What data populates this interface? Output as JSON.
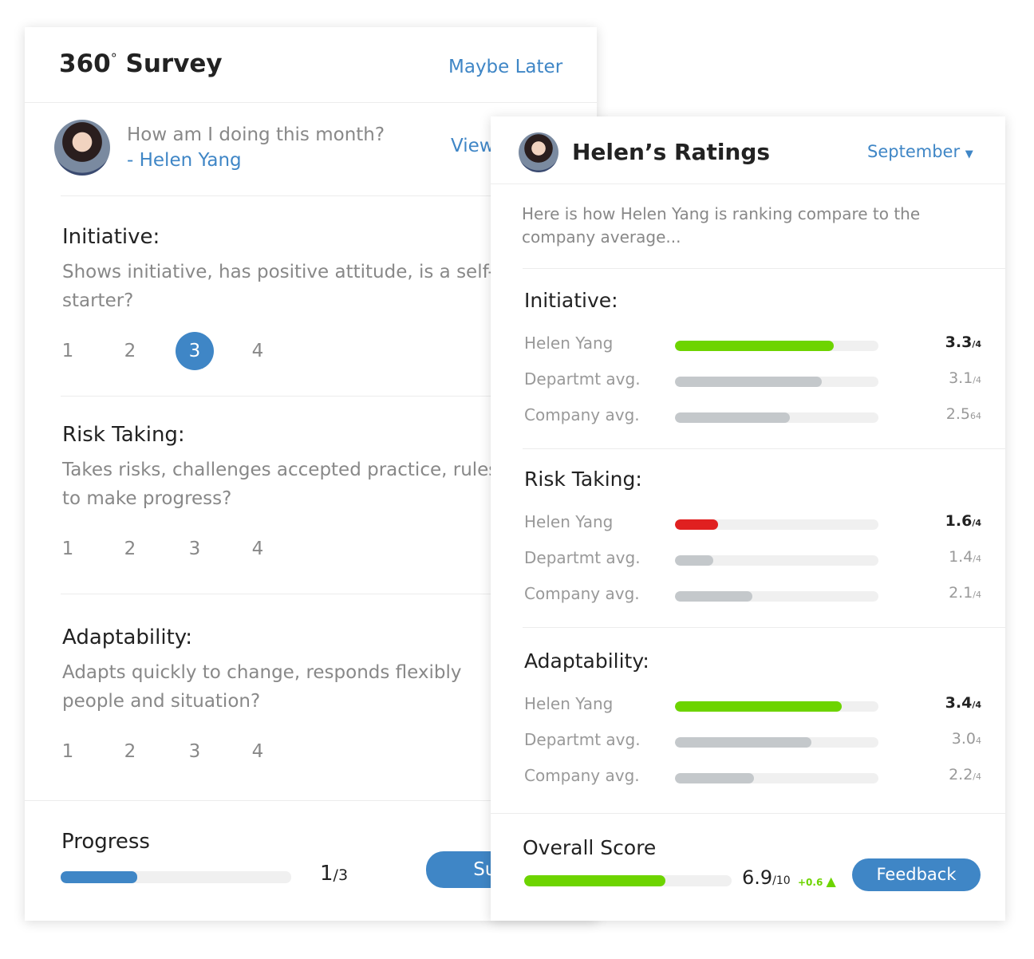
{
  "survey": {
    "title": "360",
    "degree": "°",
    "title_rest": "Survey",
    "maybe_later": "Maybe Later",
    "prompt": "How am I doing this month?",
    "author": "- Helen Yang",
    "view_link": "View",
    "questions": [
      {
        "title": "Initiative:",
        "text": "Shows initiative, has positive attitude, is a self-starter?",
        "options": [
          "1",
          "2",
          "3",
          "4"
        ],
        "selected": "3"
      },
      {
        "title": "Risk Taking:",
        "text": "Takes risks, challenges accepted practice, rules to make progress?",
        "options": [
          "1",
          "2",
          "3",
          "4"
        ],
        "selected": null
      },
      {
        "title": "Adaptability:",
        "text": "Adapts quickly to change, responds flexibly people and situation?",
        "options": [
          "1",
          "2",
          "3",
          "4"
        ],
        "selected": null
      }
    ],
    "progress_label": "Progress",
    "progress_value": "1",
    "progress_total": "/3",
    "progress_fraction": 0.333,
    "submit_label": "Submit"
  },
  "ratings": {
    "title": "Helen’s Ratings",
    "month": "September",
    "description": "Here is how Helen Yang is ranking compare to the company average...",
    "sections": [
      {
        "title": "Initiative:",
        "rows": [
          {
            "label": "Helen Yang",
            "value": "3.3",
            "suffix": "/4",
            "fill": 0.78,
            "color": "#6dd400",
            "bold": true
          },
          {
            "label": "Departmt avg.",
            "value": "3.1",
            "suffix": "/4",
            "fill": 0.72,
            "color": "#c4c8cb"
          },
          {
            "label": "Company avg.",
            "value": "2.5",
            "suffix": "64",
            "fill": 0.565,
            "color": "#c4c8cb"
          }
        ]
      },
      {
        "title": "Risk Taking:",
        "rows": [
          {
            "label": "Helen Yang",
            "value": "1.6",
            "suffix": "/4",
            "fill": 0.21,
            "color": "#e02020",
            "bold": true
          },
          {
            "label": "Departmt avg.",
            "value": "1.4",
            "suffix": "/4",
            "fill": 0.19,
            "color": "#c4c8cb"
          },
          {
            "label": "Company avg.",
            "value": "2.1",
            "suffix": "/4",
            "fill": 0.38,
            "color": "#c4c8cb"
          }
        ]
      },
      {
        "title": "Adaptability:",
        "rows": [
          {
            "label": "Helen Yang",
            "value": "3.4",
            "suffix": "/4",
            "fill": 0.82,
            "color": "#6dd400",
            "bold": true
          },
          {
            "label": "Departmt avg.",
            "value": "3.0",
            "suffix": "4",
            "fill": 0.67,
            "color": "#c4c8cb"
          },
          {
            "label": "Company avg.",
            "value": "2.2",
            "suffix": "/4",
            "fill": 0.39,
            "color": "#c4c8cb"
          }
        ]
      }
    ],
    "overall_label": "Overall Score",
    "overall_value": "6.9",
    "overall_total": "/10",
    "overall_fill": 0.68,
    "overall_delta": "+0.6",
    "feedback_label": "Feedback"
  },
  "colors": {
    "accent": "#3f86c6",
    "positive": "#6dd400",
    "negative": "#e02020"
  }
}
